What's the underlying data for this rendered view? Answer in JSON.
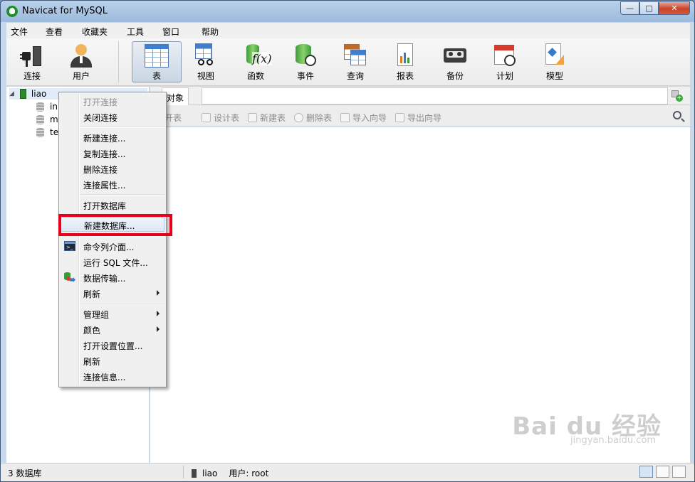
{
  "window": {
    "title": "Navicat for MySQL",
    "minimize": "—",
    "maximize": "□",
    "close": "✕"
  },
  "menubar": {
    "items": [
      "文件",
      "查看",
      "收藏夹",
      "工具",
      "窗口",
      "帮助"
    ]
  },
  "toolbar": {
    "items": [
      {
        "label": "连接",
        "icon": "plug-icon"
      },
      {
        "label": "用户",
        "icon": "user-icon"
      },
      {
        "label": "表",
        "icon": "table-icon",
        "active": true
      },
      {
        "label": "视图",
        "icon": "view-icon"
      },
      {
        "label": "函数",
        "icon": "function-icon"
      },
      {
        "label": "事件",
        "icon": "event-icon"
      },
      {
        "label": "查询",
        "icon": "query-icon"
      },
      {
        "label": "报表",
        "icon": "report-icon"
      },
      {
        "label": "备份",
        "icon": "backup-icon"
      },
      {
        "label": "计划",
        "icon": "schedule-icon"
      },
      {
        "label": "模型",
        "icon": "model-icon"
      }
    ]
  },
  "tree": {
    "connection": "liao",
    "databases": [
      "in",
      "m",
      "te"
    ]
  },
  "tabs": {
    "objects": "对象"
  },
  "object_toolbar": {
    "items": [
      "打开表",
      "设计表",
      "新建表",
      "删除表",
      "导入向导",
      "导出向导"
    ]
  },
  "context_menu": {
    "items": [
      {
        "label": "打开连接",
        "disabled": true
      },
      {
        "label": "关闭连接"
      },
      {
        "label": "新建连接..."
      },
      {
        "label": "复制连接..."
      },
      {
        "label": "删除连接"
      },
      {
        "label": "连接属性..."
      },
      {
        "label": "打开数据库"
      },
      {
        "label": "新建数据库...",
        "highlighted": true
      },
      {
        "label": "命令列介面...",
        "icon": "console-icon"
      },
      {
        "label": "运行 SQL 文件..."
      },
      {
        "label": "数据传输...",
        "icon": "data-transfer-icon"
      },
      {
        "label": "刷新",
        "submenu": true
      },
      {
        "label": "管理组",
        "submenu": true
      },
      {
        "label": "颜色",
        "submenu": true
      },
      {
        "label": "打开设置位置..."
      },
      {
        "label": "刷新"
      },
      {
        "label": "连接信息..."
      }
    ]
  },
  "statusbar": {
    "db_count": "3 数据库",
    "connection": "liao",
    "user": "用户: root"
  },
  "watermark": {
    "logo": "Bai du 经验",
    "url": "jingyan.baidu.com"
  },
  "colors": {
    "highlight_box": "#e8001b",
    "window_frame": "#c9d9ec"
  }
}
